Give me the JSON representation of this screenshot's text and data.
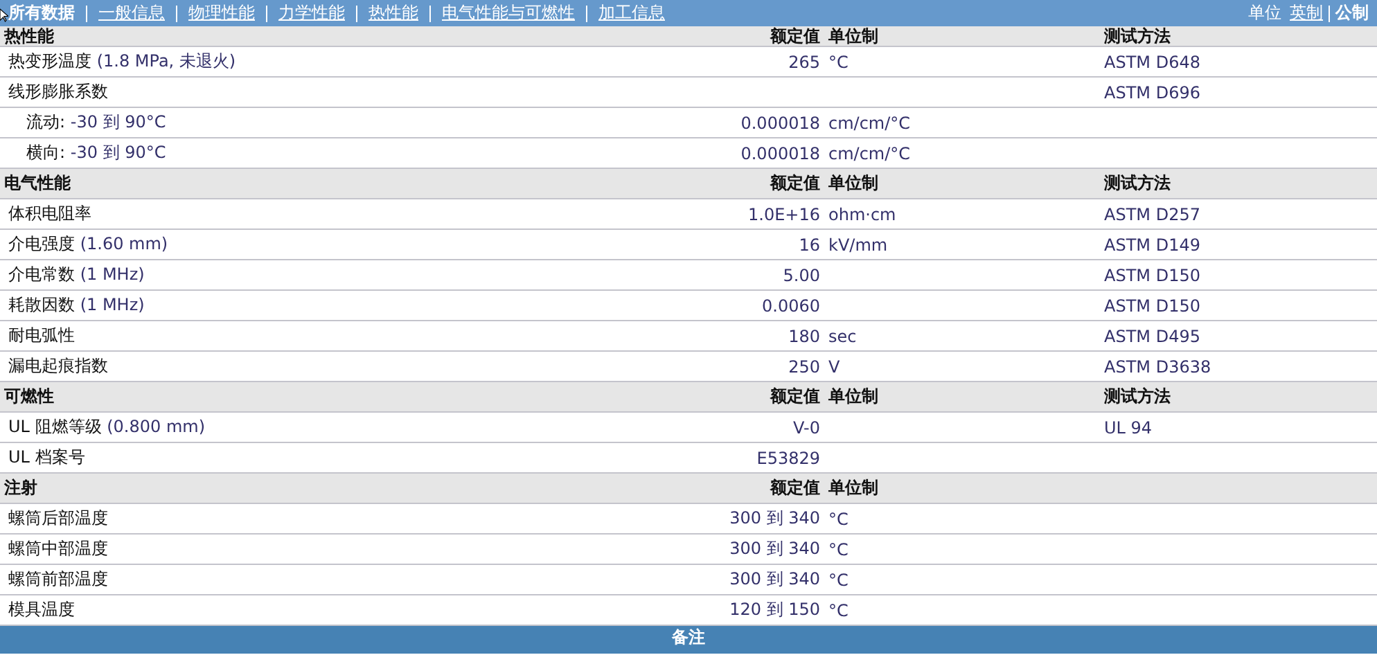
{
  "nav": {
    "tabs": [
      {
        "label": "所有数据",
        "selected": true
      },
      {
        "label": "一般信息",
        "selected": false
      },
      {
        "label": "物理性能",
        "selected": false
      },
      {
        "label": "力学性能",
        "selected": false
      },
      {
        "label": "热性能",
        "selected": false
      },
      {
        "label": "电气性能与可燃性",
        "selected": false
      },
      {
        "label": "加工信息",
        "selected": false
      }
    ],
    "units_label": "单位",
    "units": [
      {
        "label": "英制",
        "selected": false
      },
      {
        "label": "公制",
        "selected": true
      }
    ]
  },
  "sections": [
    {
      "title": "热性能",
      "columns": [
        "额定值",
        "单位制",
        "测试方法"
      ],
      "rows": [
        {
          "name": "热变形温度",
          "condition": "(1.8 MPa, 未退火)",
          "value": "265",
          "unit": "°C",
          "method": "ASTM D648"
        },
        {
          "name": "线形膨胀系数",
          "method": "ASTM D696",
          "children": [
            {
              "name": "流动:",
              "condition": "-30 到  90°C",
              "value": "0.000018",
              "unit": "cm/cm/°C"
            },
            {
              "name": "横向:",
              "condition": "-30 到  90°C",
              "value": "0.000018",
              "unit": "cm/cm/°C"
            }
          ]
        }
      ]
    },
    {
      "title": "电气性能",
      "columns": [
        "额定值",
        "单位制",
        "测试方法"
      ],
      "rows": [
        {
          "name": "体积电阻率",
          "value": "1.0E+16",
          "unit": "ohm·cm",
          "method": "ASTM D257"
        },
        {
          "name": "介电强度",
          "condition": "(1.60 mm)",
          "value": "16",
          "unit": "kV/mm",
          "method": "ASTM D149"
        },
        {
          "name": "介电常数",
          "condition": "(1 MHz)",
          "value": "5.00",
          "method": "ASTM D150"
        },
        {
          "name": "耗散因数",
          "condition": "(1 MHz)",
          "value": "0.0060",
          "method": "ASTM D150"
        },
        {
          "name": "耐电弧性",
          "value": "180",
          "unit": "sec",
          "method": "ASTM D495"
        },
        {
          "name": "漏电起痕指数",
          "value": "250",
          "unit": "V",
          "method": "ASTM D3638"
        }
      ]
    },
    {
      "title": "可燃性",
      "columns": [
        "额定值",
        "单位制",
        "测试方法"
      ],
      "rows": [
        {
          "name": "UL 阻燃等级",
          "condition": "(0.800 mm)",
          "value": "V-0",
          "method": "UL 94"
        },
        {
          "name": "UL 档案号",
          "value": "E53829"
        }
      ]
    },
    {
      "title": "注射",
      "columns": [
        "额定值",
        "单位制"
      ],
      "rows": [
        {
          "name": "螺筒后部温度",
          "value": "300 到  340",
          "unit": "°C"
        },
        {
          "name": "螺筒中部温度",
          "value": "300 到  340",
          "unit": "°C"
        },
        {
          "name": "螺筒前部温度",
          "value": "300 到  340",
          "unit": "°C"
        },
        {
          "name": "模具温度",
          "value": "120 到  150",
          "unit": "°C"
        }
      ]
    }
  ],
  "footer": {
    "title": "备注"
  }
}
